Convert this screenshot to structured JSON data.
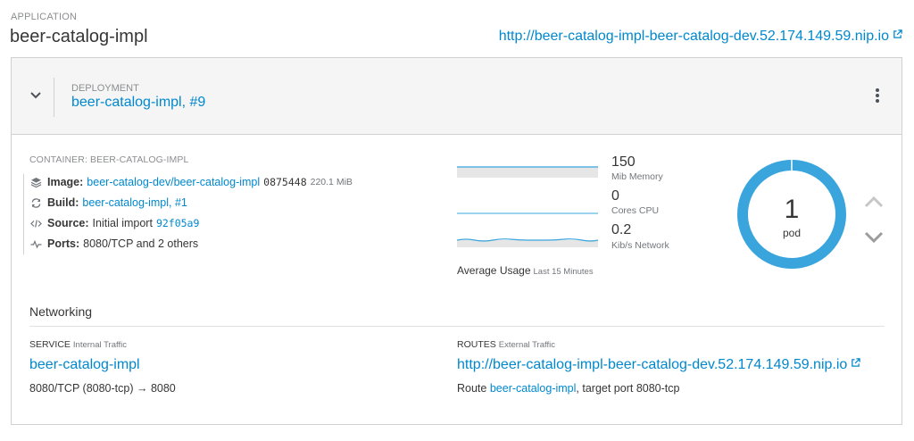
{
  "header": {
    "app_label": "APPLICATION",
    "app_name": "beer-catalog-impl",
    "app_url": "http://beer-catalog-impl-beer-catalog-dev.52.174.149.59.nip.io"
  },
  "deployment": {
    "label": "DEPLOYMENT",
    "name": "beer-catalog-impl, #9",
    "expanded": true
  },
  "container": {
    "label": "CONTAINER: BEER-CATALOG-IMPL",
    "image": {
      "key": "Image:",
      "name": "beer-catalog-dev/beer-catalog-impl",
      "hash": "0875448",
      "size": "220.1 MiB"
    },
    "build": {
      "key": "Build:",
      "name": "beer-catalog-impl, #1"
    },
    "source": {
      "key": "Source:",
      "text": "Initial import",
      "commit": "92f05a9"
    },
    "ports": {
      "key": "Ports:",
      "text": "8080/TCP and 2 others"
    }
  },
  "metrics": {
    "memory": {
      "value": "150",
      "label": "Mib Memory"
    },
    "cpu": {
      "value": "0",
      "label": "Cores CPU"
    },
    "network": {
      "value": "0.2",
      "label": "Kib/s Network"
    },
    "average_label": "Average Usage",
    "average_period": "Last 15 Minutes"
  },
  "pods": {
    "count": "1",
    "label": "pod",
    "ring_color": "#39a5dc"
  },
  "networking": {
    "title": "Networking",
    "service": {
      "label": "SERVICE",
      "sublabel": "Internal Traffic",
      "name": "beer-catalog-impl",
      "ports": "8080/TCP (8080-tcp) → 8080"
    },
    "routes": {
      "label": "ROUTES",
      "sublabel": "External Traffic",
      "url": "http://beer-catalog-impl-beer-catalog-dev.52.174.149.59.nip.io",
      "desc_prefix": "Route",
      "desc_link": "beer-catalog-impl",
      "desc_suffix": ", target port 8080-tcp"
    }
  },
  "colors": {
    "link": "#0088ce",
    "sparkline": "#39a5dc",
    "muted": "#8b8d8f"
  },
  "icons": {
    "expand": "chevron-down-icon",
    "menu": "kebab-icon",
    "external": "external-link-icon",
    "image": "layers-icon",
    "build": "refresh-icon",
    "source": "code-icon",
    "ports": "pulse-icon",
    "scale_up": "chevron-up-icon",
    "scale_down": "chevron-down-icon"
  }
}
